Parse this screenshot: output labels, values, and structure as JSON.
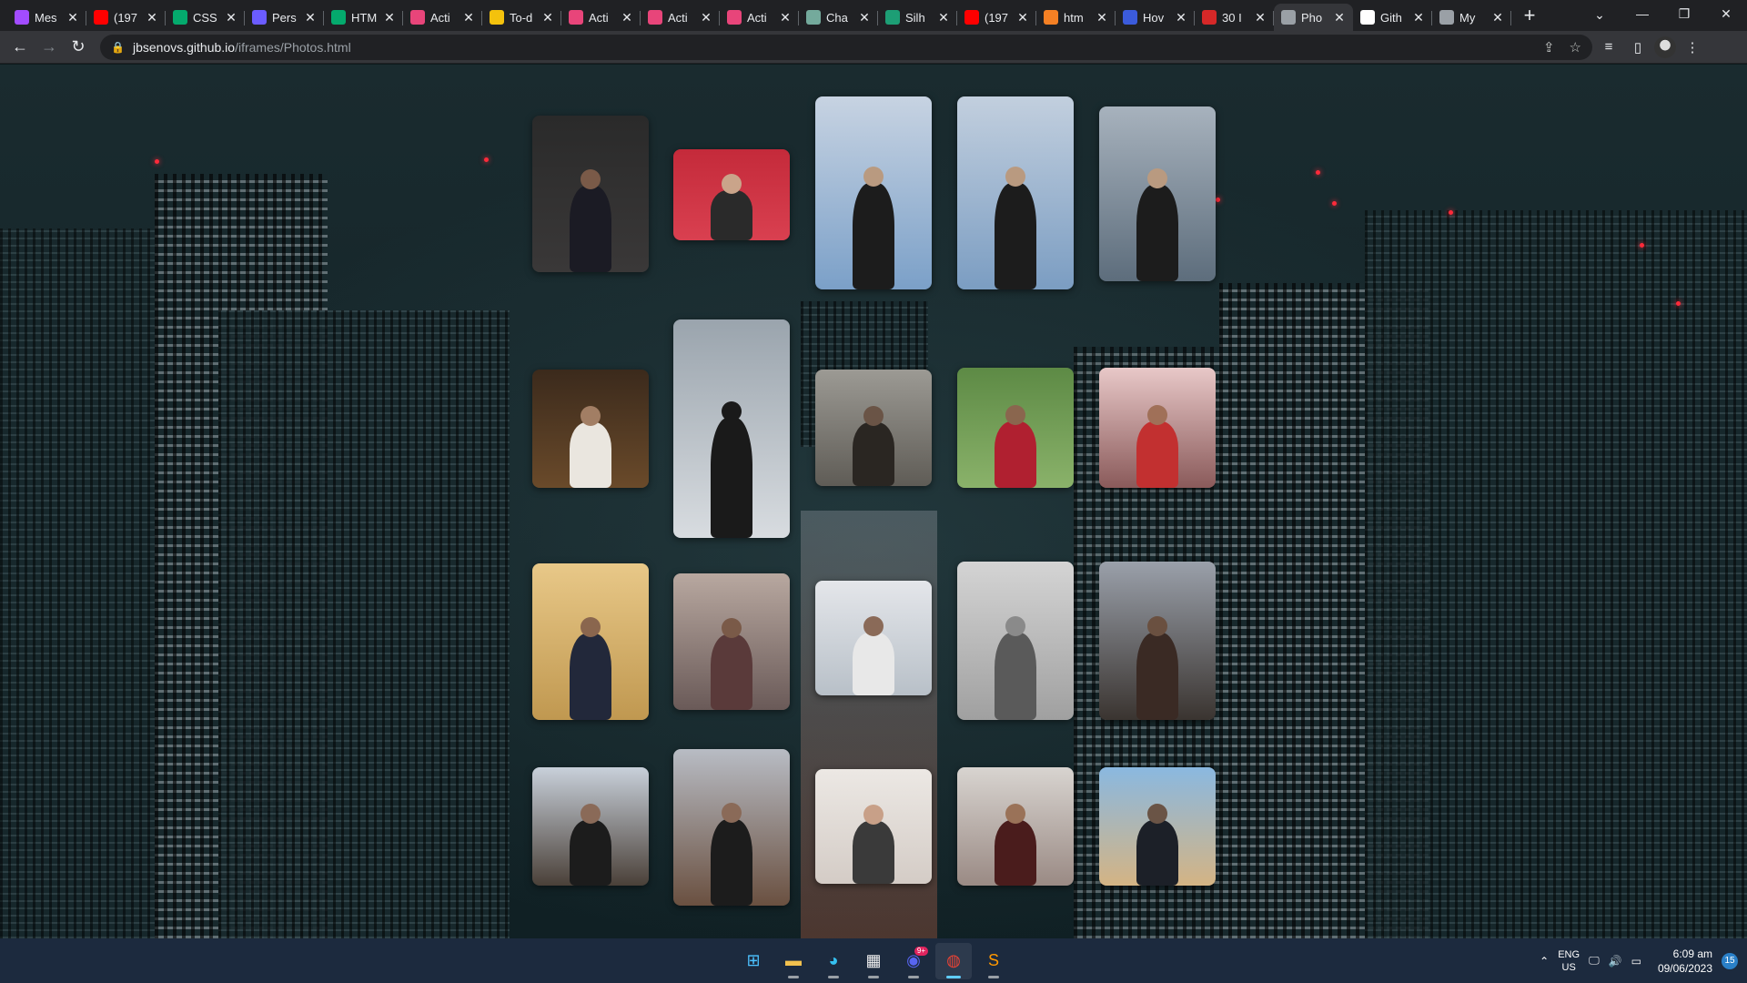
{
  "browser": {
    "tabs": [
      {
        "label": "Mes",
        "icon": "messenger-icon",
        "color": "#a24cff"
      },
      {
        "label": "(197",
        "icon": "youtube-icon",
        "color": "#ff0000"
      },
      {
        "label": "CSS",
        "icon": "w3schools-icon",
        "color": "#04aa6d"
      },
      {
        "label": "Pers",
        "icon": "globe-icon",
        "color": "#6b5cff"
      },
      {
        "label": "HTM",
        "icon": "w3schools-icon",
        "color": "#04aa6d"
      },
      {
        "label": "Acti",
        "icon": "activity-icon",
        "color": "#e8457a"
      },
      {
        "label": "To-d",
        "icon": "todo-icon",
        "color": "#f4c20d"
      },
      {
        "label": "Acti",
        "icon": "activity-icon",
        "color": "#e8457a"
      },
      {
        "label": "Acti",
        "icon": "activity-icon",
        "color": "#e8457a"
      },
      {
        "label": "Acti",
        "icon": "activity-icon",
        "color": "#e8457a"
      },
      {
        "label": "Cha",
        "icon": "chatgpt-icon",
        "color": "#74aa9c"
      },
      {
        "label": "Silh",
        "icon": "silhouette-icon",
        "color": "#1d9e75"
      },
      {
        "label": "(197",
        "icon": "youtube-icon",
        "color": "#ff0000"
      },
      {
        "label": "htm",
        "icon": "stackoverflow-icon",
        "color": "#f48024"
      },
      {
        "label": "Hov",
        "icon": "bookmark-icon",
        "color": "#3b5bdb"
      },
      {
        "label": "30 I",
        "icon": "sl-icon",
        "color": "#d62828"
      },
      {
        "label": "Pho",
        "icon": "globe-icon",
        "color": "#9aa0a6",
        "active": true
      },
      {
        "label": "Gith",
        "icon": "github-icon",
        "color": "#ffffff"
      },
      {
        "label": "My",
        "icon": "globe-icon",
        "color": "#9aa0a6"
      }
    ],
    "url_host": "jbsenovs.github.io",
    "url_path": "/iframes/Photos.html"
  },
  "gallery": {
    "photos": [
      {
        "name": "photo-boy-suit",
        "sky": "#2a2a2a",
        "top": "#3a3838",
        "fig": "#1b1b24",
        "skin": "#7a5a48"
      },
      {
        "name": "photo-group-red-wall",
        "sky": "#c42a3a",
        "top": "#d94050",
        "fig": "#2a2a2a",
        "skin": "#caa48a"
      },
      {
        "name": "photo-guitar-seaside-1",
        "sky": "#c7d3e2",
        "top": "#7ba0c8",
        "fig": "#1c1c1c",
        "skin": "#b99a80"
      },
      {
        "name": "photo-guitar-seaside-2",
        "sky": "#c2cfde",
        "top": "#7b9dc2",
        "fig": "#1c1c1c",
        "skin": "#b99a80"
      },
      {
        "name": "photo-pole-seaside",
        "sky": "#a7b2bd",
        "top": "#5d6d7c",
        "fig": "#1c1c1c",
        "skin": "#b99a80"
      },
      {
        "name": "photo-tree-night",
        "sky": "#3b2a1c",
        "top": "#6a4a2a",
        "fig": "#eae6df",
        "skin": "#a27e64"
      },
      {
        "name": "photo-silhouette-sea",
        "sky": "#9aa4ad",
        "top": "#d8dce0",
        "fig": "#1a1a1a",
        "skin": "#1a1a1a"
      },
      {
        "name": "photo-sunset-mask",
        "sky": "#9c9a94",
        "top": "#5f5c56",
        "fig": "#2a2622",
        "skin": "#6a5446"
      },
      {
        "name": "photo-greenery",
        "sky": "#5d8a45",
        "top": "#8ab26a",
        "fig": "#b02030",
        "skin": "#8a664e"
      },
      {
        "name": "photo-red-window",
        "sky": "#e8c8c8",
        "top": "#8a5a5a",
        "fig": "#c23030",
        "skin": "#a07058"
      },
      {
        "name": "photo-window-stripes",
        "sky": "#e8c888",
        "top": "#c09850",
        "fig": "#22283a",
        "skin": "#8a664e"
      },
      {
        "name": "photo-wall-dusk",
        "sky": "#b8a8a0",
        "top": "#6a5a58",
        "fig": "#5a3a3a",
        "skin": "#7a5a48"
      },
      {
        "name": "photo-building-white",
        "sky": "#e4e6ea",
        "top": "#b8c0c8",
        "fig": "#e8e8e8",
        "skin": "#8a6a58"
      },
      {
        "name": "photo-guitar-bw",
        "sky": "#d4d4d4",
        "top": "#a0a0a0",
        "fig": "#5a5a5a",
        "skin": "#8a8a8a"
      },
      {
        "name": "photo-tree-canopy",
        "sky": "#9aa0aa",
        "top": "#3a3430",
        "fig": "#3a2a24",
        "skin": "#6a5040"
      },
      {
        "name": "photo-tree-trunk-lake",
        "sky": "#c8d0da",
        "top": "#4a4038",
        "fig": "#1c1c1c",
        "skin": "#8a6a58"
      },
      {
        "name": "photo-tree-reflection",
        "sky": "#b8bcc4",
        "top": "#6a5040",
        "fig": "#1c1c1c",
        "skin": "#8a6a58"
      },
      {
        "name": "photo-boy-pillow",
        "sky": "#ece8e4",
        "top": "#d4ccc6",
        "fig": "#3a3a3a",
        "skin": "#c8a088"
      },
      {
        "name": "photo-selfie-glasses",
        "sky": "#d8d4d0",
        "top": "#9a8a84",
        "fig": "#4a1c1c",
        "skin": "#9a7258"
      },
      {
        "name": "photo-motorbike",
        "sky": "#8ab8e0",
        "top": "#d4b484",
        "fig": "#1c2028",
        "skin": "#6a5446"
      }
    ]
  },
  "taskbar": {
    "apps": [
      {
        "name": "start-button",
        "glyph": "⊞",
        "color": "#4cc2ff"
      },
      {
        "name": "file-explorer-app",
        "glyph": "▬",
        "color": "#f2c14e"
      },
      {
        "name": "edge-app",
        "glyph": "◕",
        "color": "#35c1f1"
      },
      {
        "name": "store-app",
        "glyph": "▦",
        "color": "#f0f0f0"
      },
      {
        "name": "discord-app",
        "glyph": "◉",
        "color": "#5865f2",
        "badge": "9+"
      },
      {
        "name": "chrome-app",
        "glyph": "◍",
        "color": "#ea4335",
        "active": true
      },
      {
        "name": "sublime-app",
        "glyph": "S",
        "color": "#ff9800"
      }
    ],
    "lang_top": "ENG",
    "lang_bottom": "US",
    "time": "6:09 am",
    "date": "09/06/2023",
    "notifications": "15"
  }
}
